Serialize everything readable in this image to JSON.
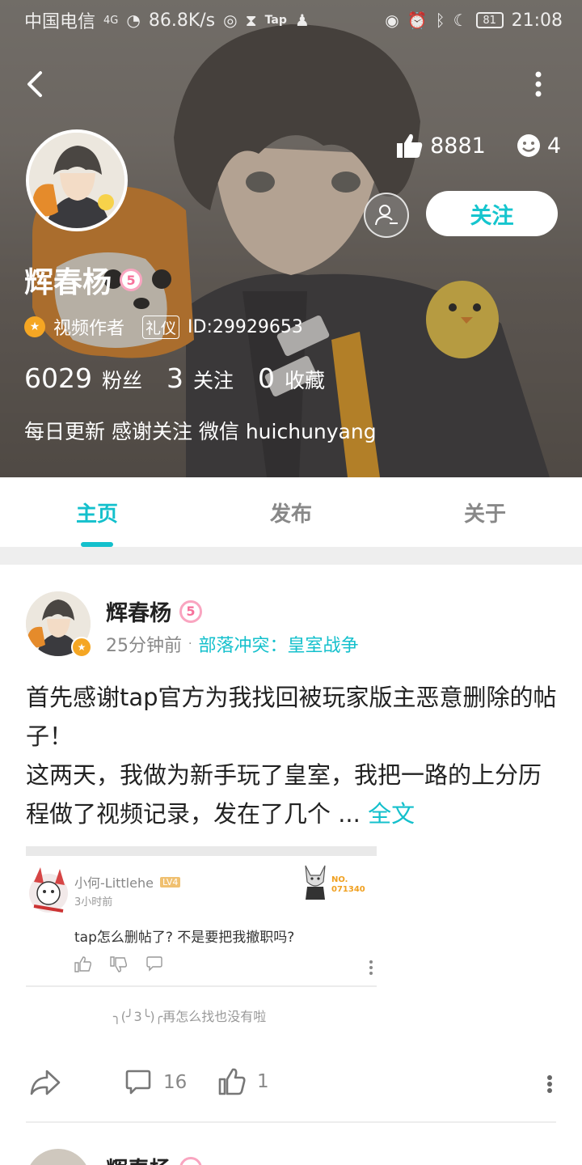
{
  "status_bar": {
    "carrier": "中国电信",
    "network": "4G",
    "speed": "86.8K/s",
    "app_label": "Tap",
    "battery": "81",
    "time": "21:08"
  },
  "profile": {
    "likes": "8881",
    "smiles": "4",
    "follow_label": "关注",
    "name": "辉春杨",
    "level": "5",
    "role": "视频作者",
    "etiquette_tag": "礼仪",
    "id_text": "ID:29929653",
    "fans_count": "6029",
    "fans_label": "粉丝",
    "following_count": "3",
    "following_label": "关注",
    "favorites_count": "0",
    "favorites_label": "收藏",
    "bio": "每日更新 感谢关注 微信 huichunyang"
  },
  "tabs": [
    {
      "label": "主页",
      "active": true
    },
    {
      "label": "发布",
      "active": false
    },
    {
      "label": "关于",
      "active": false
    }
  ],
  "post": {
    "author": "辉春杨",
    "level": "5",
    "time": "25分钟前",
    "dot": "·",
    "forum": "部落冲突：皇室战争",
    "body_line1": "首先感谢tap官方为我找回被玩家版主恶意删除的帖子！",
    "body_line2": "这两天，我做为新手玩了皇室，我把一路的上分历程做了视频记录，发在了几个 ...",
    "more_label": "全文",
    "embedded_comment": {
      "user": "小何-Littlehe",
      "level": "LV4",
      "time": "3小时前",
      "badge_no": "NO.",
      "badge_num": "071340",
      "text": "tap怎么删帖了? 不是要把我撤职吗?"
    },
    "caption": "╮(╯3╰)╭再怎么找也没有啦",
    "comments": "16",
    "likes": "1"
  },
  "next_post": {
    "author": "辉春杨"
  },
  "colors": {
    "accent": "#14c0cc",
    "pink": "#f7719b",
    "creator_orange": "#f5a623"
  }
}
